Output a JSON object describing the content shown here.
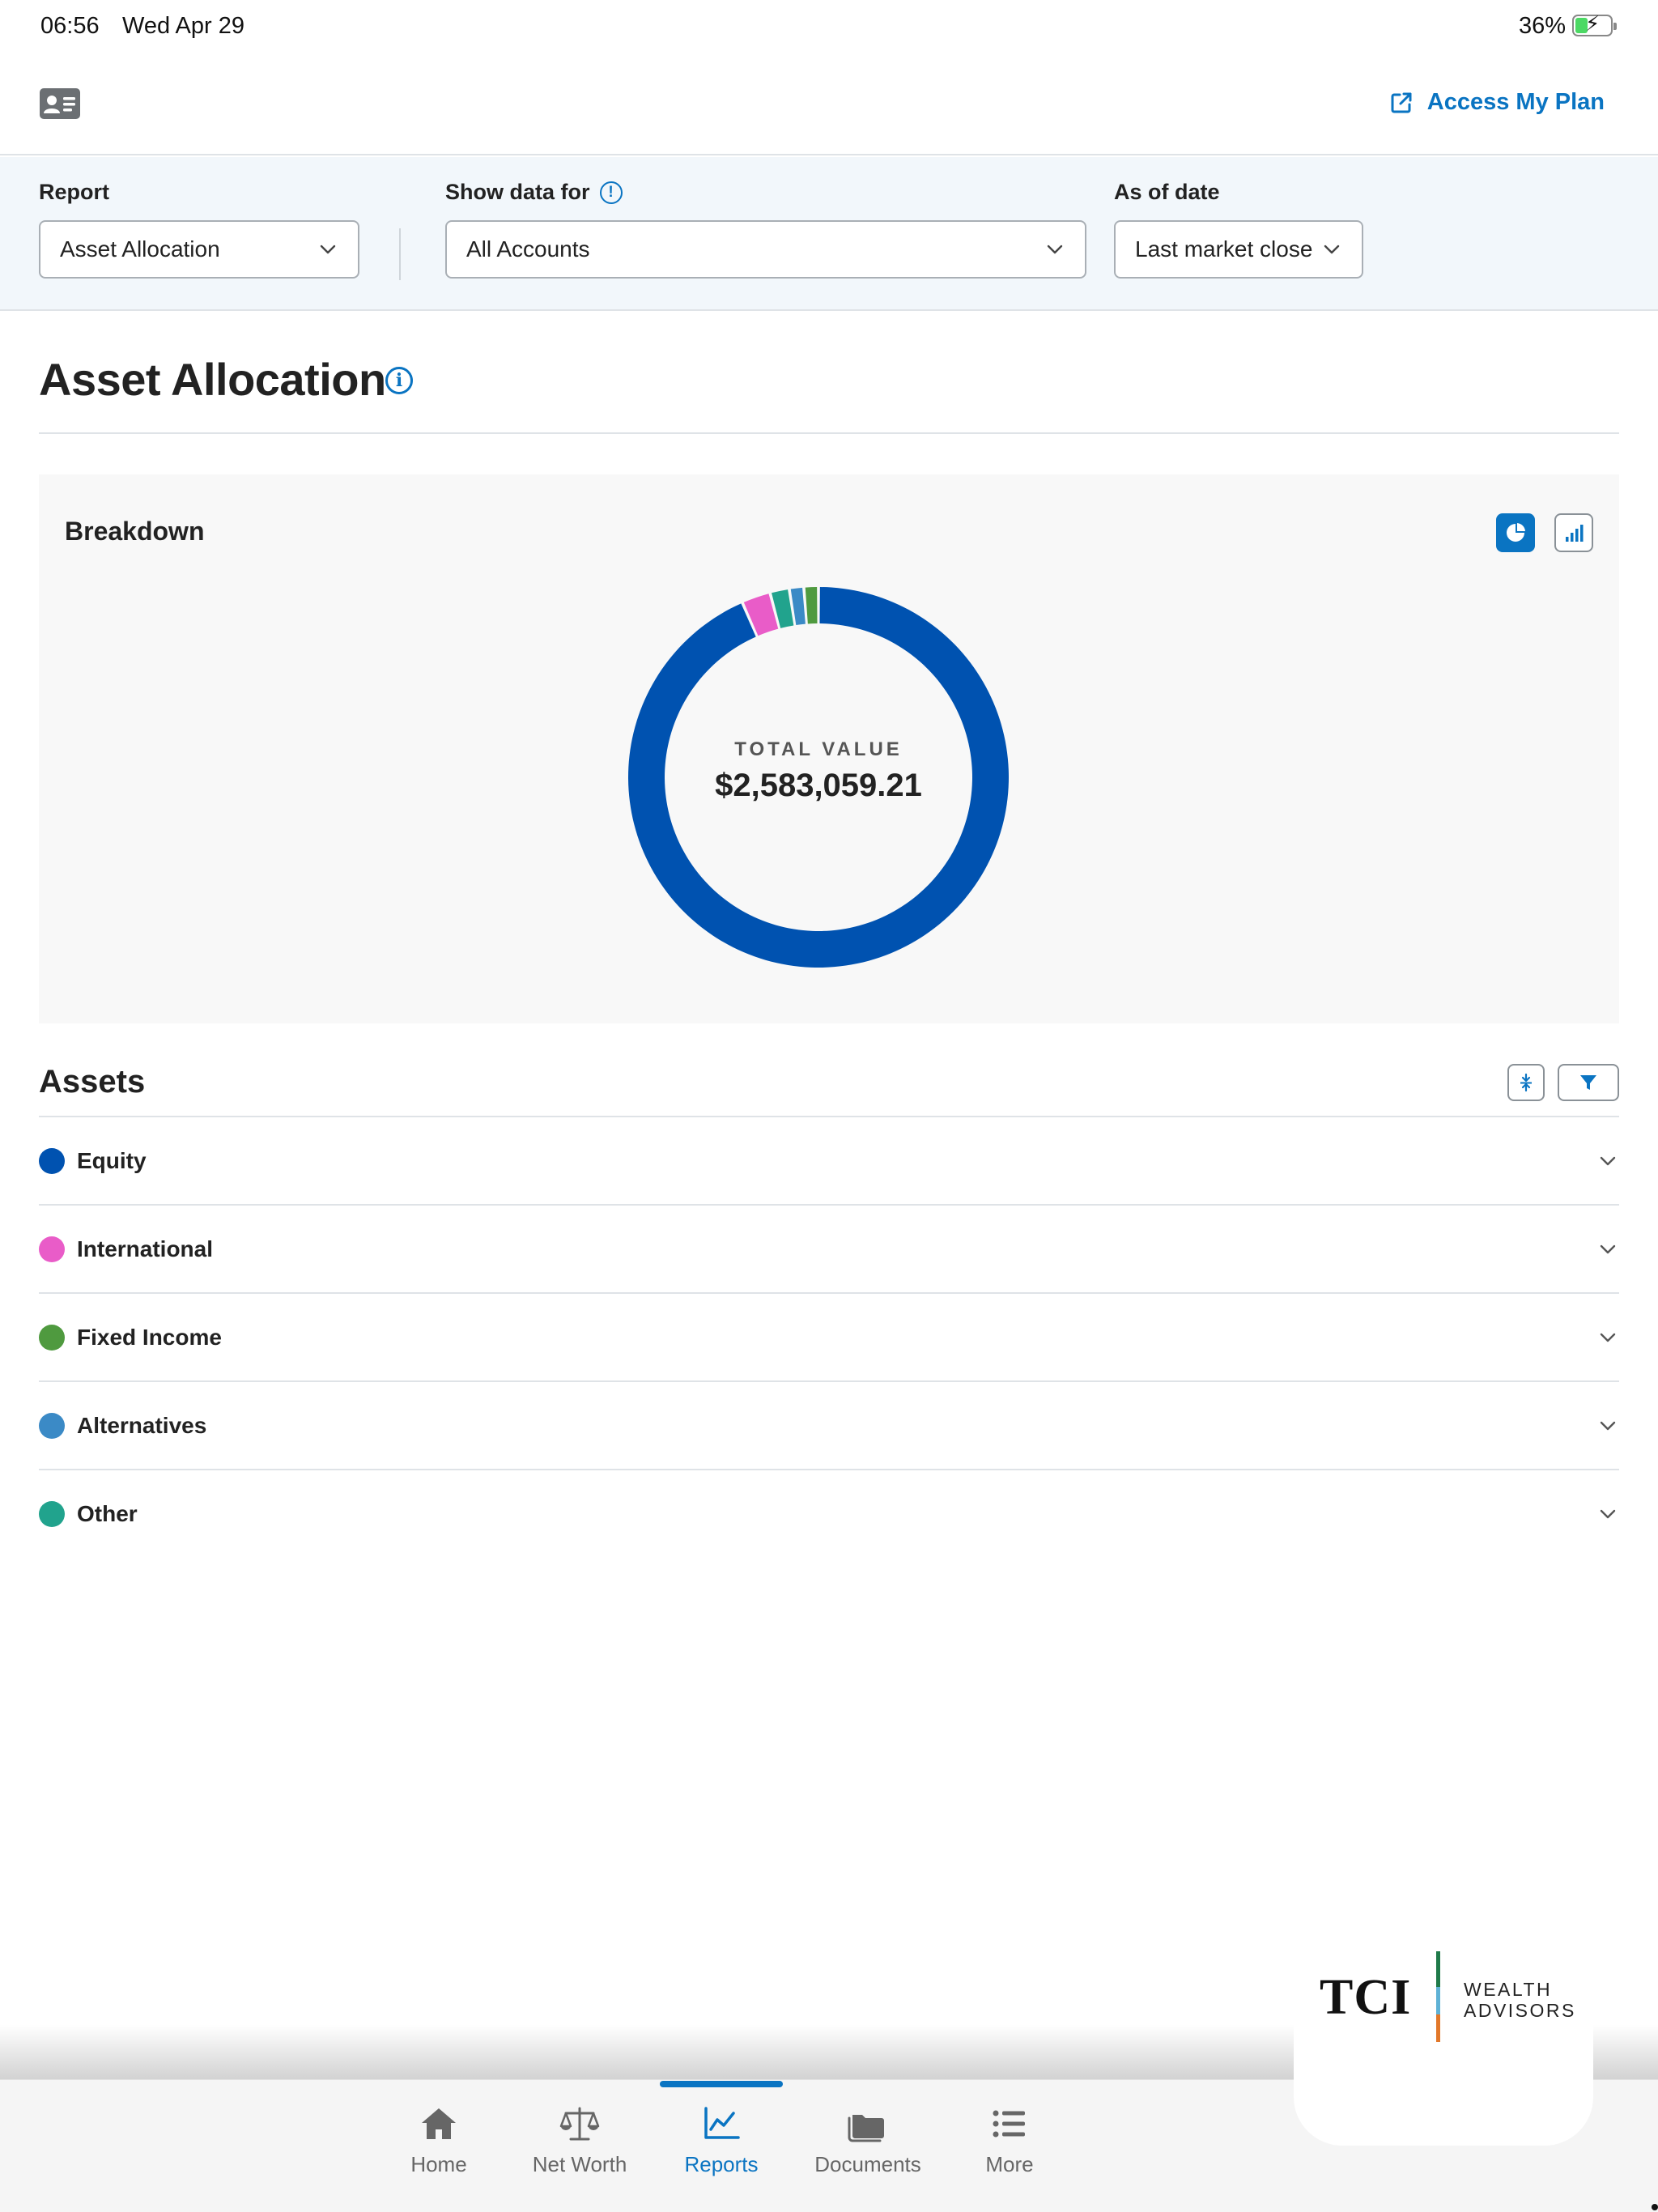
{
  "status_bar": {
    "time": "06:56",
    "date": "Wed Apr 29",
    "battery_percent": "36%",
    "battery_level": 0.36
  },
  "header": {
    "profile_icon": "contact-card-icon",
    "access_link_icon": "external-link-icon",
    "access_link_label": "Access My Plan"
  },
  "filters": {
    "report": {
      "label": "Report",
      "value": "Asset Allocation"
    },
    "show_data_for": {
      "label": "Show data for",
      "value": "All Accounts",
      "info_symbol": "!"
    },
    "as_of_date": {
      "label": "As of date",
      "value": "Last market close"
    }
  },
  "page": {
    "title": "Asset Allocation",
    "info_symbol": "i"
  },
  "breakdown": {
    "title": "Breakdown",
    "views": [
      "pie-chart-icon",
      "bar-chart-icon"
    ],
    "active_view": "pie",
    "total_label": "TOTAL VALUE",
    "total_value": "$2,583,059.21"
  },
  "chart_data": {
    "type": "pie",
    "style": "donut",
    "categories": [
      "Equity",
      "International",
      "Other",
      "Alternatives",
      "Fixed Income"
    ],
    "values": [
      91.4,
      2.4,
      1.6,
      1.2,
      1.2
    ],
    "colors": [
      "#0052b0",
      "#e95cc8",
      "#21a38d",
      "#3b8ac6",
      "#4f9a3f"
    ],
    "title": "",
    "center_label": "TOTAL VALUE",
    "center_value": "$2,583,059.21"
  },
  "assets": {
    "title": "Assets",
    "collapse_icon": "collapse-all-icon",
    "filter_icon": "filter-icon",
    "items": [
      {
        "name": "Equity",
        "color": "#0052b0"
      },
      {
        "name": "International",
        "color": "#e95cc8"
      },
      {
        "name": "Fixed Income",
        "color": "#4f9a3f"
      },
      {
        "name": "Alternatives",
        "color": "#3b8ac6"
      },
      {
        "name": "Other",
        "color": "#21a38d"
      }
    ]
  },
  "logo": {
    "brand": "TCI",
    "line1": "WEALTH",
    "line2": "ADVISORS"
  },
  "tabbar": {
    "active": "Reports",
    "tabs": [
      {
        "label": "Home",
        "icon": "home-icon"
      },
      {
        "label": "Net Worth",
        "icon": "scale-icon"
      },
      {
        "label": "Reports",
        "icon": "line-chart-icon"
      },
      {
        "label": "Documents",
        "icon": "folder-icon"
      },
      {
        "label": "More",
        "icon": "list-icon"
      }
    ]
  },
  "colors": {
    "accent": "#0a74c2",
    "filter_bar_bg": "#f2f7fb",
    "card_bg": "#f8f8f8"
  }
}
